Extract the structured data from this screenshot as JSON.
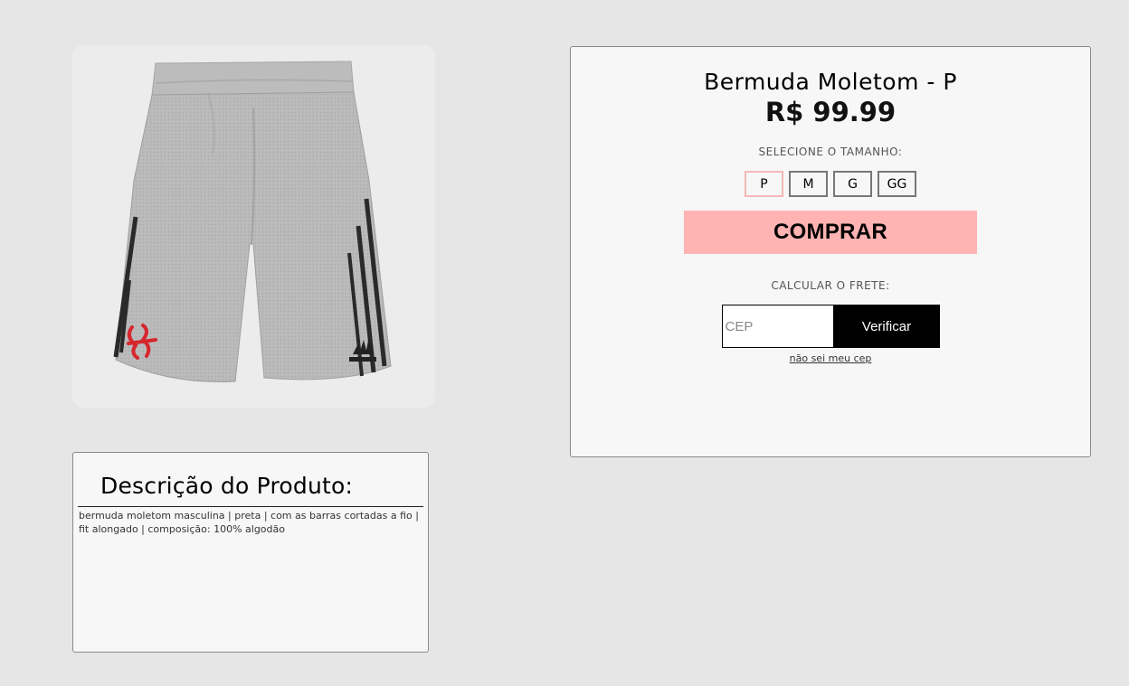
{
  "product": {
    "name": "Bermuda Moletom - P",
    "price": "R$ 99.99"
  },
  "sizes": {
    "label": "SELECIONE O TAMANHO:",
    "options": [
      "P",
      "M",
      "G",
      "GG"
    ],
    "selected": "P"
  },
  "buy_button": "COMPRAR",
  "shipping": {
    "label": "CALCULAR O FRETE:",
    "cep_placeholder": "CEP",
    "cep_value": "",
    "verify_button": "Verificar",
    "unknown_cep_link": "não sei meu cep"
  },
  "description": {
    "title": "Descrição do Produto:",
    "text": "bermuda moletom masculina | preta | com as barras cortadas a fio | fit alongado | composição: 100% algodão"
  },
  "image": {
    "subject": "grey sweat shorts with black side stripes and club crest",
    "colors": {
      "fabric": "#b8b8b8",
      "stripe": "#2a2a2a",
      "crest": "#d7262e"
    }
  },
  "colors": {
    "background": "#e6e6e6",
    "card": "#f7f7f7",
    "buy_button": "#ffb3b3",
    "selected_size_border": "#f6b7b7",
    "verify_button": "#000000"
  }
}
